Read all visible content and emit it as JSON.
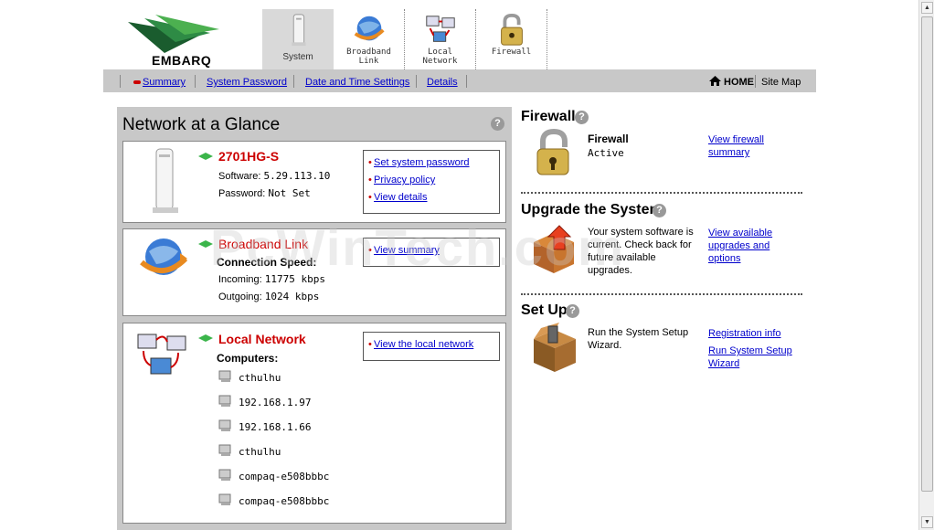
{
  "brand": {
    "name": "EMBARQ"
  },
  "tabs": [
    {
      "label": "System",
      "active": true
    },
    {
      "label": "Broadband\nLink",
      "active": false
    },
    {
      "label": "Local\nNetwork",
      "active": false
    },
    {
      "label": "Firewall",
      "active": false
    }
  ],
  "subnav": {
    "summary": "Summary",
    "system_password": "System Password",
    "date_time": "Date and Time Settings",
    "details": "Details",
    "home": "HOME",
    "site_map": "Site Map"
  },
  "glance": {
    "title": "Network at a Glance",
    "device": {
      "name": "2701HG-S",
      "software_label": "Software:",
      "software_value": "5.29.113.10",
      "password_label": "Password:",
      "password_value": "Not Set",
      "links": [
        "Set system password",
        "Privacy policy",
        "View details"
      ]
    },
    "broadband": {
      "title": "Broadband Link",
      "speed_label": "Connection Speed:",
      "incoming_label": "Incoming:",
      "incoming_value": "11775 kbps",
      "outgoing_label": "Outgoing:",
      "outgoing_value": "1024 kbps",
      "links": [
        "View summary"
      ]
    },
    "local": {
      "title": "Local Network",
      "computers_label": "Computers:",
      "computers": [
        "cthulhu",
        "192.168.1.97",
        "192.168.1.66",
        "cthulhu",
        "compaq-e508bbbc",
        "compaq-e508bbbc"
      ],
      "links": [
        "View the local network"
      ]
    }
  },
  "firewall": {
    "heading": "Firewall",
    "label": "Firewall",
    "status": "Active",
    "link": "View firewall summary"
  },
  "upgrade": {
    "heading": "Upgrade the System",
    "text": "Your system software is current. Check back for future available upgrades.",
    "link": "View available upgrades and options"
  },
  "setup": {
    "heading": "Set Up",
    "text": "Run the System Setup Wizard.",
    "link1": "Registration info",
    "link2": "Run System Setup Wizard"
  },
  "watermark": "PcWinTech.com",
  "colors": {
    "accent_red": "#cc0000",
    "link_blue": "#0000cc",
    "panel_gray": "#c8c8c8",
    "logo_green": "#1e7a3a"
  }
}
